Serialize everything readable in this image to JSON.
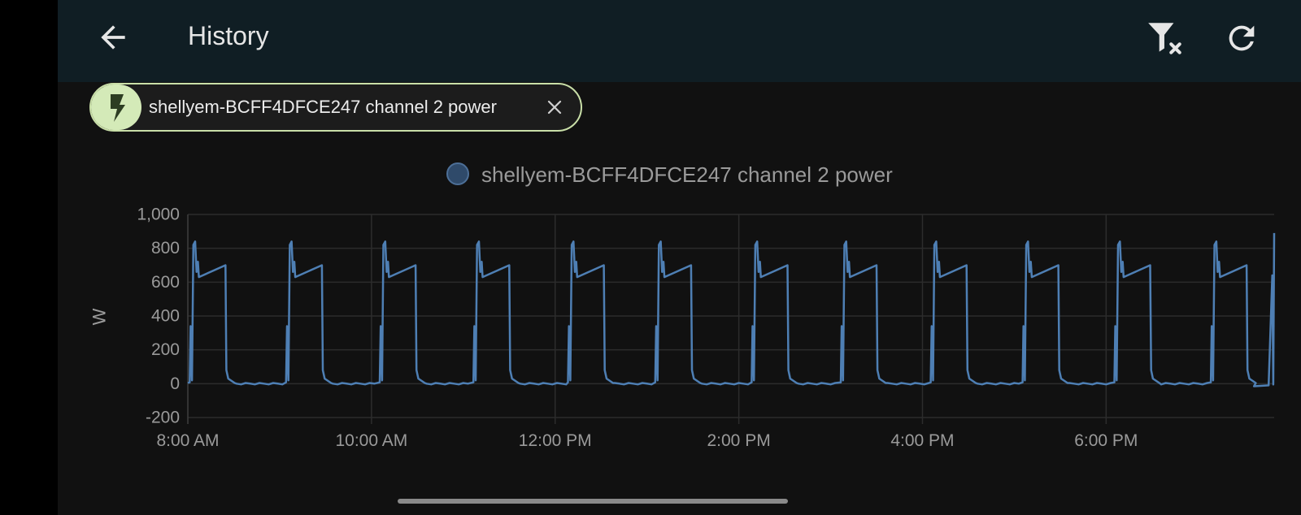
{
  "toolbar": {
    "title": "History"
  },
  "icons": {
    "back": "arrow-left-icon",
    "filter_clear": "filter-remove-icon",
    "refresh": "refresh-icon",
    "entity": "flash-icon",
    "chip_close": "close-icon"
  },
  "chip": {
    "label": "shellyem-BCFF4DFCE247 channel 2 power"
  },
  "colors": {
    "toolbar_bg": "#101e24",
    "page_bg": "#111111",
    "chip_accent": "#d4eab8",
    "series_line": "#4e7fb4"
  },
  "chart_data": {
    "type": "line",
    "xlabel": "",
    "ylabel": "W",
    "ylim": [
      -200,
      1000
    ],
    "yticks": [
      "1,000",
      "800",
      "600",
      "400",
      "200",
      "0",
      "-200"
    ],
    "ytick_values": [
      1000,
      800,
      600,
      400,
      200,
      0,
      -200
    ],
    "xlim_hours": [
      8.0,
      19.83
    ],
    "xticks": [
      "8:00 AM",
      "10:00 AM",
      "12:00 PM",
      "2:00 PM",
      "4:00 PM",
      "6:00 PM"
    ],
    "xtick_hours": [
      8,
      10,
      12,
      14,
      16,
      18
    ],
    "grid": true,
    "legend_position": "top-center",
    "series": [
      {
        "name": "shellyem-BCFF4DFCE247 channel 2 power",
        "cycle_start_hours": [
          8.03,
          9.08,
          10.1,
          11.12,
          12.15,
          13.1,
          14.15,
          15.12,
          16.1,
          17.1,
          18.1,
          19.15
        ],
        "on_duration_hours": 0.38,
        "peak_w": 840,
        "plateau_start_w": 630,
        "plateau_end_w": 700,
        "off_w": 0,
        "last_value_w": 890
      }
    ]
  }
}
